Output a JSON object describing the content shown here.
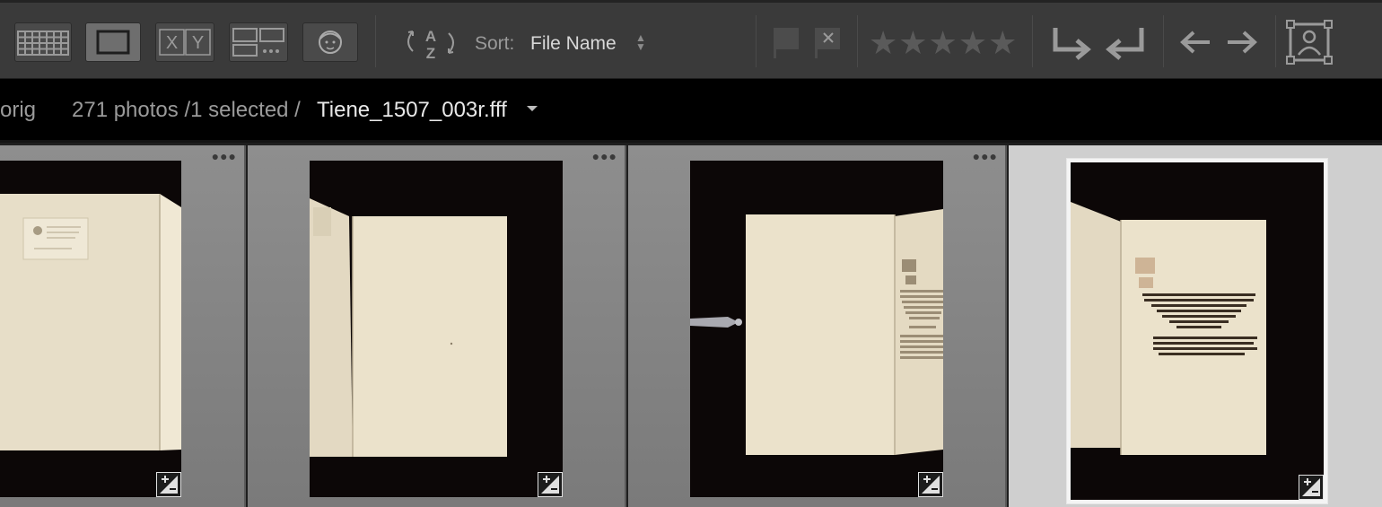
{
  "toolbar": {
    "views": [
      {
        "id": "grid-view",
        "label": "Grid view",
        "icon": "grid-icon",
        "active": false
      },
      {
        "id": "loupe-view",
        "label": "Loupe view",
        "icon": "loupe-icon",
        "active": true
      },
      {
        "id": "compare-view",
        "label": "X Y",
        "icon": "compare-icon",
        "active": false
      },
      {
        "id": "survey-view",
        "label": "Survey view",
        "icon": "survey-icon",
        "active": false
      },
      {
        "id": "people-view",
        "label": "People view",
        "icon": "face-icon",
        "active": false
      }
    ],
    "sort_direction_icon": "az-sort-icon",
    "sort_label": "Sort:",
    "sort_value": "File Name",
    "flag_icons": [
      "flag-pick-icon",
      "flag-reject-icon"
    ],
    "stars": "★★★★★",
    "rotate_icons": [
      "rotate-left-icon",
      "rotate-right-icon"
    ],
    "nav_icons": [
      "arrow-left-icon",
      "arrow-right-icon"
    ],
    "crop_icon": "portrait-crop-icon"
  },
  "info": {
    "source": "orig",
    "count_text": "271 photos /1 selected /",
    "filename": "Tiene_1507_003r.fff"
  },
  "grid": {
    "cells": [
      {
        "id": "cell-1",
        "dots": "●●●",
        "selected": false,
        "kind": "cover-label"
      },
      {
        "id": "cell-2",
        "dots": "●●●",
        "selected": false,
        "kind": "cover-blank"
      },
      {
        "id": "cell-3",
        "dots": "●●●",
        "selected": false,
        "kind": "spread-bookmark"
      },
      {
        "id": "cell-4",
        "dots": "",
        "selected": true,
        "kind": "title-page"
      }
    ]
  },
  "colors": {
    "toolbar_bg": "#3a3a3a",
    "info_bg": "#000000",
    "cell_bg": "#8e8e8e",
    "cell_selected_bg": "#cfcfcf",
    "parchment": "#e9dfc6"
  }
}
